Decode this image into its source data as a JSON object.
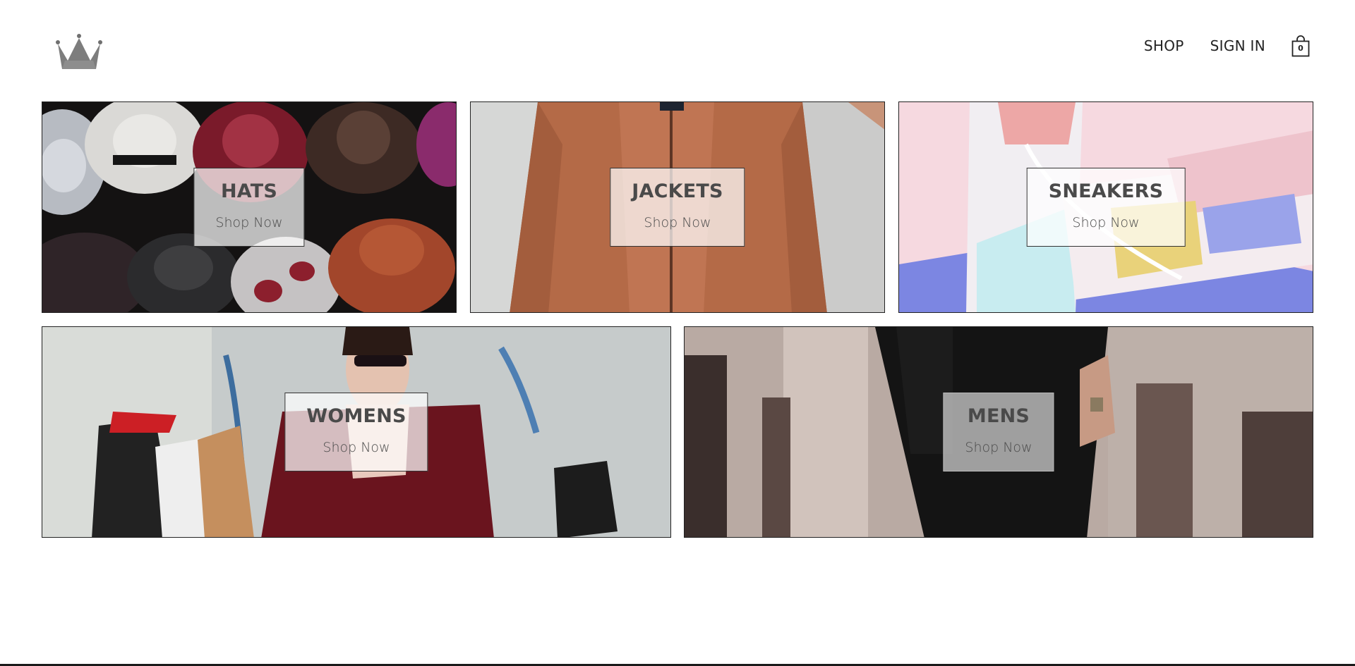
{
  "nav": {
    "shop_label": "SHOP",
    "signin_label": "SIGN IN",
    "cart_count": "0"
  },
  "logo": {
    "icon": "crown-icon"
  },
  "categories": [
    {
      "title": "HATS",
      "cta": "Shop Now"
    },
    {
      "title": "JACKETS",
      "cta": "Shop Now"
    },
    {
      "title": "SNEAKERS",
      "cta": "Shop Now"
    },
    {
      "title": "WOMENS",
      "cta": "Shop Now"
    },
    {
      "title": "MENS",
      "cta": "Shop Now"
    }
  ],
  "colors": {
    "text": "#333333",
    "border": "#222222",
    "overlay": "#ffffff",
    "logo": "#808080"
  }
}
